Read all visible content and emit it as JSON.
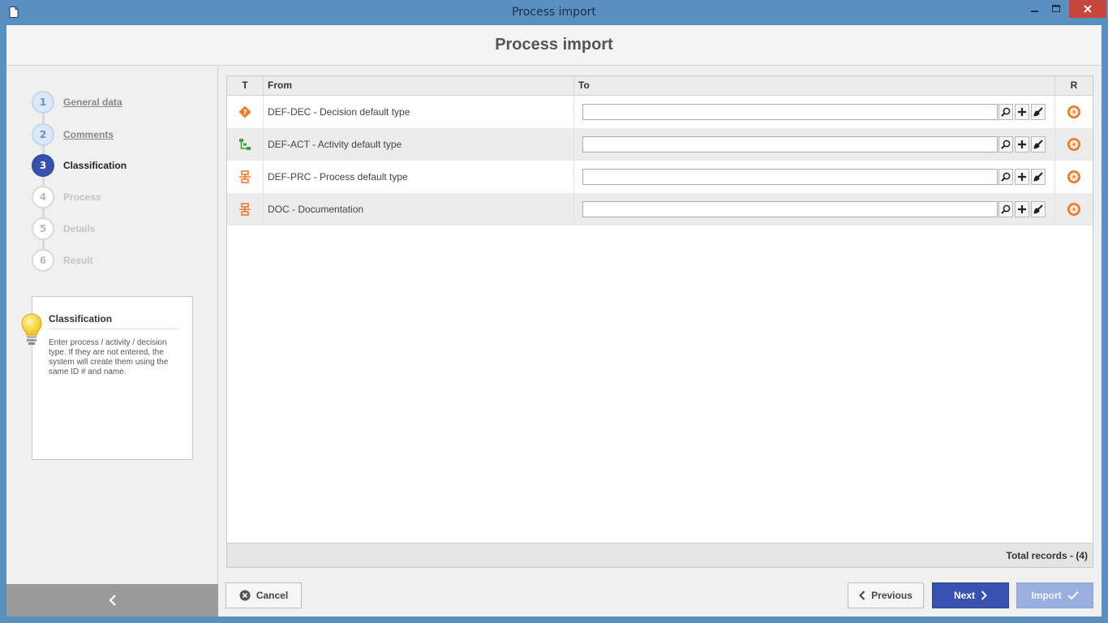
{
  "window": {
    "title": "Process import"
  },
  "header": {
    "title": "Process import"
  },
  "steps": [
    {
      "num": "1",
      "label": "General data",
      "state": "done"
    },
    {
      "num": "2",
      "label": "Comments",
      "state": "done"
    },
    {
      "num": "3",
      "label": "Classification",
      "state": "active"
    },
    {
      "num": "4",
      "label": "Process",
      "state": "future"
    },
    {
      "num": "5",
      "label": "Details",
      "state": "future"
    },
    {
      "num": "6",
      "label": "Result",
      "state": "future"
    }
  ],
  "hint": {
    "title": "Classification",
    "text": "Enter process / activity / decision type. If they are not entered, the system will create them using the same ID # and name."
  },
  "grid": {
    "columns": {
      "t": "T",
      "from": "From",
      "to": "To",
      "r": "R"
    },
    "rows": [
      {
        "icon": "decision-type-icon",
        "from": "DEF-DEC - Decision default type",
        "to": ""
      },
      {
        "icon": "activity-type-icon",
        "from": "DEF-ACT - Activity default type",
        "to": ""
      },
      {
        "icon": "process-type-icon",
        "from": "DEF-PRC - Process default type",
        "to": ""
      },
      {
        "icon": "process-type-icon",
        "from": "DOC - Documentation",
        "to": ""
      }
    ],
    "total_label": "Total records",
    "total_count": " - (4)"
  },
  "buttons": {
    "cancel": "Cancel",
    "previous": "Previous",
    "next": "Next",
    "import": "Import"
  },
  "colors": {
    "accent": "#3651b0",
    "titlebar": "#5a8fc2",
    "close": "#c7463c",
    "icon_orange": "#f07a2a",
    "icon_green": "#3aa53a"
  }
}
